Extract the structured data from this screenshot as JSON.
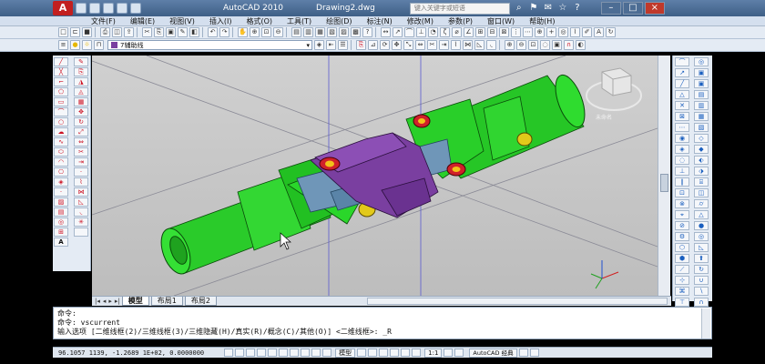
{
  "titlebar": {
    "logo": "A",
    "app_name": "AutoCAD 2010",
    "doc_name": "Drawing2.dwg",
    "search_placeholder": "键入关键字或短语"
  },
  "menu": [
    "文件(F)",
    "编辑(E)",
    "视图(V)",
    "插入(I)",
    "格式(O)",
    "工具(T)",
    "绘图(D)",
    "标注(N)",
    "修改(M)",
    "参数(P)",
    "窗口(W)",
    "帮助(H)"
  ],
  "layer": {
    "name": "7辅助线",
    "color": "#7a3fa0"
  },
  "viewcube": {
    "label": "未命名"
  },
  "tabs": [
    "模型",
    "布局1",
    "布局2"
  ],
  "command": {
    "line1": "命令:",
    "line2": "命令:  vscurrent",
    "line3": "输入选项 [二维线框(2)/三维线框(3)/三维隐藏(H)/真实(R)/概念(C)/其他(O)] <二维线框>: _R"
  },
  "status": {
    "coords": "96.1057 1139,  -1.2689 1E+02, 0.0000000",
    "model_label": "模型",
    "scale": "1:1",
    "workspace": "AutoCAD 经典"
  },
  "colors": {
    "accent": "#c21f1f",
    "cad_green": "#22dd22",
    "cad_purple": "#7a3fa0",
    "cad_steel": "#6f96b8"
  }
}
